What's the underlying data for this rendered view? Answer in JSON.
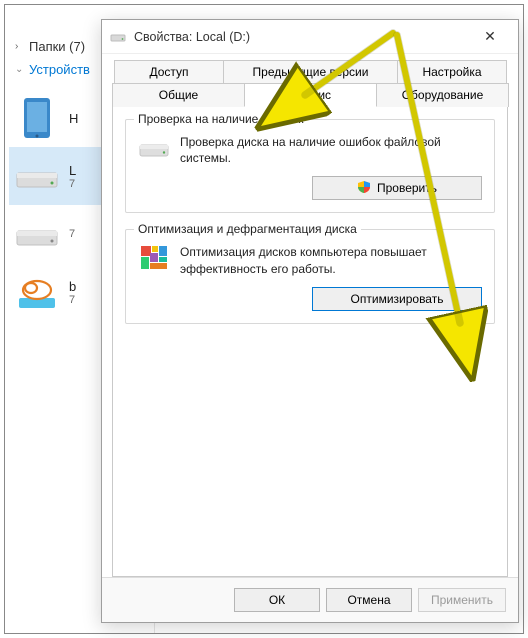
{
  "bg": {
    "folders_label": "Папки (7)",
    "devices_label": "Устройств",
    "dev1": "H",
    "dev2": "L",
    "dev2_sub": "7",
    "dev3": "7",
    "dev4": "b",
    "dev4_sub": "7"
  },
  "dialog": {
    "title": "Свойства: Local (D:)",
    "close_symbol": "✕"
  },
  "tabs": {
    "row1": [
      "Доступ",
      "Предыдущие версии",
      "Настройка"
    ],
    "row2": [
      "Общие",
      "Сервис",
      "Оборудование"
    ]
  },
  "groups": {
    "check": {
      "label": "Проверка на наличие ошибок",
      "text": "Проверка диска на наличие ошибок файловой системы.",
      "button": "Проверить"
    },
    "optimize": {
      "label": "Оптимизация и дефрагментация диска",
      "text": "Оптимизация дисков компьютера повышает эффективность его работы.",
      "button": "Оптимизировать"
    }
  },
  "footer": {
    "ok": "ОК",
    "cancel": "Отмена",
    "apply": "Применить"
  }
}
